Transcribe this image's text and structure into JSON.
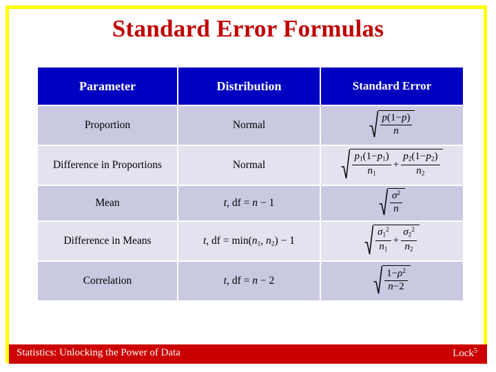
{
  "slide": {
    "title": "Standard Error Formulas",
    "border_color": "#ffff00",
    "title_color": "#c00000",
    "background": "#ffffff"
  },
  "table": {
    "header_bg": "#0000c0",
    "header_text_color": "#ffffff",
    "row_dark_bg": "#c9c9e2",
    "row_light_bg": "#e3e3f0",
    "headers": {
      "parameter": "Parameter",
      "distribution": "Distribution",
      "standard_error": "Standard Error"
    },
    "rows": [
      {
        "parameter": "Proportion",
        "distribution": "Normal",
        "standard_error_text": "sqrt( p(1 - p) / n )"
      },
      {
        "parameter": "Difference in Proportions",
        "distribution": "Normal",
        "standard_error_text": "sqrt( p1(1 - p1)/n1 + p2(1 - p2)/n2 )"
      },
      {
        "parameter": "Mean",
        "distribution": "t, df = n - 1",
        "standard_error_text": "sqrt( sigma^2 / n )"
      },
      {
        "parameter": "Difference in Means",
        "distribution": "t, df = min(n1, n2) - 1",
        "standard_error_text": "sqrt( sigma1^2/n1 + sigma2^2/n2 )"
      },
      {
        "parameter": "Correlation",
        "distribution": "t, df = n - 2",
        "standard_error_text": "sqrt( (1 - rho^2) / (n - 2) )"
      }
    ],
    "math_symbols": {
      "p": "p",
      "n": "n",
      "one": "1",
      "minus": "−",
      "plus": "+",
      "sigma": "σ",
      "rho": "ρ",
      "two": "2",
      "sub1": "1",
      "sub2": "2",
      "sup2": "2",
      "lparen": "(",
      "rparen": ")",
      "comma": ",",
      "t": "t",
      "df": "df",
      "equals": "=",
      "min": "min"
    }
  },
  "footer": {
    "left_text": "Statistics: Unlocking the Power of Data",
    "right_text": "Lock",
    "right_superscript": "5",
    "bg_color": "#cc0000",
    "text_color": "#ffffff"
  }
}
